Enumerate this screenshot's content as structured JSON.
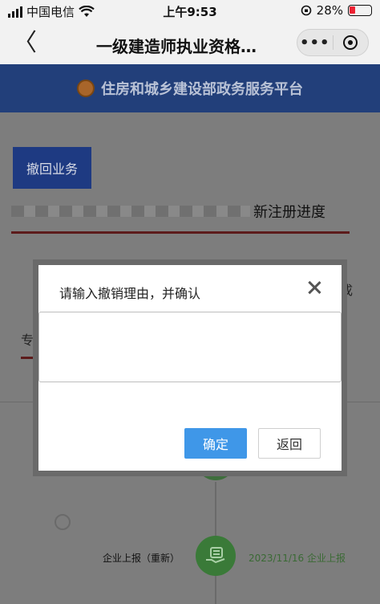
{
  "status_bar": {
    "carrier": "中国电信",
    "time": "上午9:53",
    "battery": "28%"
  },
  "nav": {
    "back_glyph": "〈",
    "title": "一级建造师执业资格…",
    "more_glyph": "•••"
  },
  "page": {
    "banner_title": "住房和城乡建设部政务服务平台",
    "tab_button": "撤回业务",
    "progress_label": "新注册进度",
    "side_fragment_right": "成",
    "side_fragment_left": "专",
    "timeline": {
      "left_label": "企业上报（重新）",
      "right_label": "2023/11/16 企业上报"
    }
  },
  "dialog": {
    "title": "请输入撤销理由，并确认",
    "input_value": "",
    "confirm_label": "确定",
    "back_label": "返回"
  },
  "colors": {
    "banner_bg": "#223f7a",
    "confirm_bg": "#3f97e8",
    "timeline_green": "#3a7a38",
    "accent_red": "#5c1b1b"
  },
  "icons": [
    "signal-icon",
    "wifi-icon",
    "lock-rotation-icon",
    "battery-icon",
    "back-chevron-icon",
    "more-icon",
    "mini-program-close-icon",
    "national-emblem-icon",
    "dialog-close-icon",
    "report-hand-icon"
  ]
}
